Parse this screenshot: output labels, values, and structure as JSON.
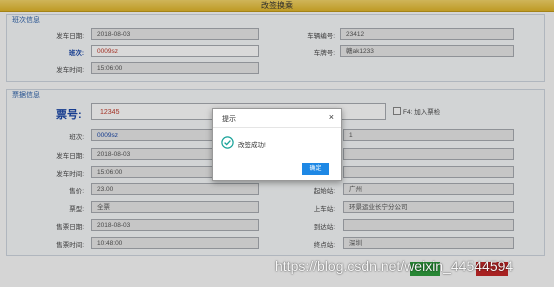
{
  "window": {
    "title": "改签换乘"
  },
  "trip_section": {
    "title": "班次信息",
    "depart_date_label": "发车日期:",
    "depart_date": "2018-08-03",
    "shift_label": "班次:",
    "shift": "0009sz",
    "depart_time_label": "发车时间:",
    "depart_time": "15:06:00",
    "vehicle_no_label": "车辆编号:",
    "vehicle_no": "23412",
    "plate_label": "车牌号:",
    "plate": "赣ak1233"
  },
  "ticket_section": {
    "title": "票据信息",
    "ticket_no_label": "票号:",
    "ticket_no": "12345",
    "f4_label": "F4: 加入票检",
    "shift_label": "班次:",
    "shift": "0009sz",
    "depart_date_label": "发车日期:",
    "depart_date": "2018-08-03",
    "depart_time_label": "发车时间:",
    "depart_time": "15:06:00",
    "price_label": "售价:",
    "price": "23.00",
    "ticket_type_label": "票型:",
    "ticket_type": "全票",
    "sale_date_label": "售票日期:",
    "sale_date": "2018-08-03",
    "sale_time_label": "售票时间:",
    "sale_time": "10:48:00",
    "right_value_1": "1",
    "origin_label": "起始站:",
    "origin": "广州",
    "boarding_label": "上车站:",
    "boarding": "环景运业长宁分公司",
    "arrival_label": "到达站:",
    "arrival": "",
    "terminal_label": "终点站:",
    "terminal": "深圳"
  },
  "dialog": {
    "title": "提示",
    "message": "改签成功!",
    "ok_label": "确定",
    "close_glyph": "×"
  },
  "watermark": {
    "text": "https://blog.csdn.net/weixin_44544594"
  },
  "colors": {
    "accent": "#1e88e5",
    "titlebar": "#e8c340",
    "label_blue": "#1a47a8"
  }
}
